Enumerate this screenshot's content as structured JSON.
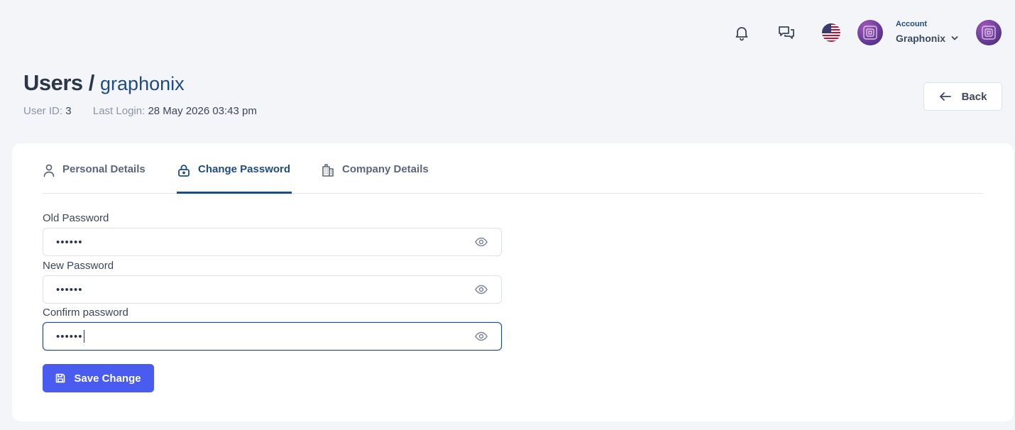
{
  "header": {
    "account_label": "Account",
    "account_name": "Graphonix"
  },
  "page": {
    "title": "Users /",
    "title_sub": "graphonix",
    "user_id_label": "User ID:",
    "user_id_value": "3",
    "last_login_label": "Last Login:",
    "last_login_value": "28 May 2026 03:43 pm",
    "back_label": "Back"
  },
  "tabs": [
    {
      "label": "Personal Details",
      "icon": "user-icon"
    },
    {
      "label": "Change Password",
      "icon": "lock-icon",
      "active": true
    },
    {
      "label": "Company Details",
      "icon": "building-icon"
    }
  ],
  "form": {
    "old_password_label": "Old Password",
    "old_password_value": "••••••",
    "new_password_label": "New Password",
    "new_password_value": "••••••",
    "confirm_password_label": "Confirm password",
    "confirm_password_value": "••••••",
    "save_label": "Save Change"
  },
  "colors": {
    "brand_primary": "#1e4c84",
    "button_primary": "#4a5cf0",
    "background": "#f4f5f9"
  }
}
